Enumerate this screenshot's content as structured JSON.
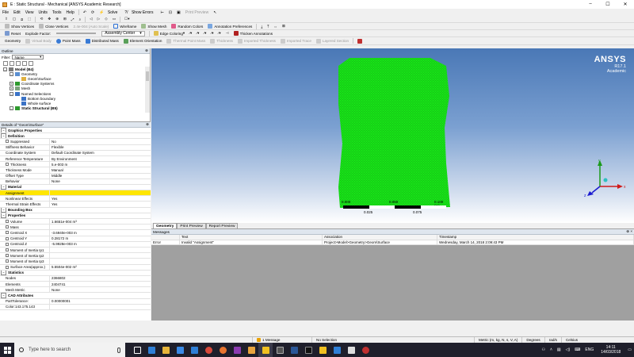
{
  "window": {
    "title": "E : Static Structural - Mechanical [ANSYS Academic Research]",
    "controls": [
      "–",
      "☐",
      "✕"
    ]
  },
  "menu": [
    "File",
    "Edit",
    "View",
    "Units",
    "Tools",
    "Help"
  ],
  "toolbar1": {
    "solve": "Solve",
    "show_errors": "Show Errors",
    "print_preview": "Print Preview"
  },
  "toolbar2": {
    "show_vertices": "Show Vertices",
    "close_vertices": "Close Vertices",
    "auto_scale": "2.4e-004 (Auto Scale)",
    "wireframe": "Wireframe",
    "show_mesh": "Show Mesh",
    "random_colors": "Random Colors",
    "annotation_prefs": "Annotation Preferences"
  },
  "toolbar3": {
    "reset": "Reset",
    "explode_factor": "Explode Factor:",
    "assembly_center": "Assembly Center",
    "edge_coloring": "Edge Coloring",
    "thicken_annotations": "Thicken Annotations"
  },
  "toolbar4": [
    "Geometry",
    "Virtual Body",
    "Point Mass",
    "Distributed Mass",
    "Element Orientation",
    "Thermal Point Mass",
    "Thickness",
    "Imported Thickness",
    "Imported Trace",
    "Layered Section"
  ],
  "outline": {
    "header": "Outline",
    "filter_label": "Filter:",
    "filter_value": "Name",
    "tree": [
      {
        "label": "Model (B4)",
        "indent": 0,
        "bold": true,
        "exp": "–"
      },
      {
        "label": "Geometry",
        "indent": 1,
        "exp": "–"
      },
      {
        "label": "Geom\\Surface",
        "indent": 2,
        "exp": ""
      },
      {
        "label": "Coordinate Systems",
        "indent": 1,
        "exp": "+"
      },
      {
        "label": "Mesh",
        "indent": 1,
        "exp": "+"
      },
      {
        "label": "Named Selections",
        "indent": 1,
        "exp": "–"
      },
      {
        "label": "Bottom boundary",
        "indent": 2,
        "exp": ""
      },
      {
        "label": "Whole surface",
        "indent": 2,
        "exp": ""
      },
      {
        "label": "Static Structural (B5)",
        "indent": 1,
        "bold": true,
        "exp": "–"
      }
    ]
  },
  "details": {
    "header": "Details of \"Geom\\Surface\"",
    "rows": [
      {
        "type": "sec",
        "k": "Graphics Properties",
        "collapsed": true
      },
      {
        "type": "sec",
        "k": "Definition"
      },
      {
        "k": "Suppressed",
        "v": "No",
        "cb": true
      },
      {
        "k": "Stiffness Behavior",
        "v": "Flexible"
      },
      {
        "k": "Coordinate System",
        "v": "Default Coordinate System"
      },
      {
        "k": "Reference Temperature",
        "v": "By Environment"
      },
      {
        "k": "Thickness",
        "v": "5.e-003 m",
        "cb": true
      },
      {
        "k": "Thickness Mode",
        "v": "Manual"
      },
      {
        "k": "Offset Type",
        "v": "Middle"
      },
      {
        "k": "Behavior",
        "v": "None"
      },
      {
        "type": "sec",
        "k": "Material"
      },
      {
        "k": "Assignment",
        "v": "",
        "hl": true
      },
      {
        "k": "Nonlinear Effects",
        "v": "Yes"
      },
      {
        "k": "Thermal Strain Effects",
        "v": "Yes"
      },
      {
        "type": "sec",
        "k": "Bounding Box",
        "collapsed": true
      },
      {
        "type": "sec",
        "k": "Properties"
      },
      {
        "k": "Volume",
        "v": "1.6651e-004 m³",
        "cb": true
      },
      {
        "k": "Mass",
        "v": "",
        "cb": true
      },
      {
        "k": "Centroid X",
        "v": "-3.6940e-003 m",
        "cb": true
      },
      {
        "k": "Centroid Y",
        "v": "0.28172 m",
        "cb": true
      },
      {
        "k": "Centroid Z",
        "v": "-5.9928e-003 m",
        "cb": true
      },
      {
        "k": "Moment of Inertia Ip1",
        "v": "",
        "cb": true
      },
      {
        "k": "Moment of Inertia Ip2",
        "v": "",
        "cb": true
      },
      {
        "k": "Moment of Inertia Ip3",
        "v": "",
        "cb": true
      },
      {
        "k": "Surface Area(approx.)",
        "v": "5.5504e-002 m²",
        "cb": true
      },
      {
        "type": "sec",
        "k": "Statistics"
      },
      {
        "k": "Nodes",
        "v": "2366802"
      },
      {
        "k": "Elements",
        "v": "2404741"
      },
      {
        "k": "Mesh Metric",
        "v": "None"
      },
      {
        "type": "sec",
        "k": "CAD Attributes"
      },
      {
        "k": "PartTolerance:",
        "v": "0.00000001"
      },
      {
        "k": "Color:143.175.143",
        "v": ""
      }
    ]
  },
  "viewport": {
    "brand": "ANSYS",
    "version": "R17.1",
    "edition": "Academic",
    "body_color": "#19e619",
    "scale_labels": [
      "0.000",
      "0.050",
      "0.100 (m)",
      "0.025",
      "0.075"
    ],
    "axes": [
      "x",
      "y",
      "z"
    ]
  },
  "tabs": [
    "Geometry",
    "Print Preview",
    "Report Preview"
  ],
  "messages": {
    "header": "Messages",
    "columns": [
      "",
      "Text",
      "Association",
      "Timestamp"
    ],
    "rows": [
      [
        "Error",
        "Invalid \"Assignment\"",
        "Project>Model>Geometry>Geom\\Surface",
        "Wednesday, March 14, 2018 2:09:43 PM"
      ]
    ]
  },
  "status": {
    "messages": "1 Message",
    "selection": "No Selection",
    "units": "Metric (m, kg, N, s, V, A)",
    "angle": "Degrees",
    "rate": "rad/s",
    "temp": "Celsius"
  },
  "taskbar": {
    "search_placeholder": "Type here to search",
    "time": "14:11",
    "date": "14/03/2018",
    "lang": "ENG"
  }
}
